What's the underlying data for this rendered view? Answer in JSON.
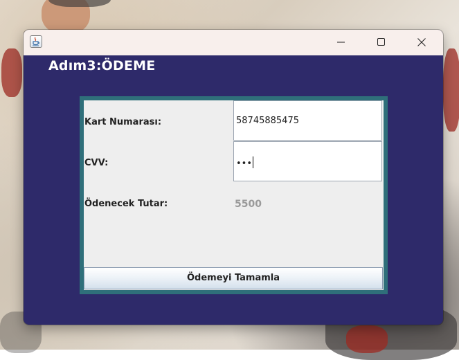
{
  "window": {
    "heading": "Adım3:ÖDEME"
  },
  "titlebar": {
    "icon": "java-cup-icon",
    "buttons": [
      "minimize-icon",
      "maximize-icon",
      "close-icon"
    ]
  },
  "form": {
    "card_number_label": "Kart Numarası:",
    "card_number_value": "58745885475",
    "cvv_label": "CVV:",
    "cvv_masked": "•••",
    "amount_label": "Ödenecek Tutar:",
    "amount_value": "5500",
    "submit_label": "Ödemeyi Tamamla"
  },
  "colors": {
    "window_background": "#2e2a6a",
    "panel_border": "#2f6f7a",
    "panel_background": "#eeeeee",
    "titlebar": "#f8efec",
    "amount_text": "#9a9a9a"
  }
}
